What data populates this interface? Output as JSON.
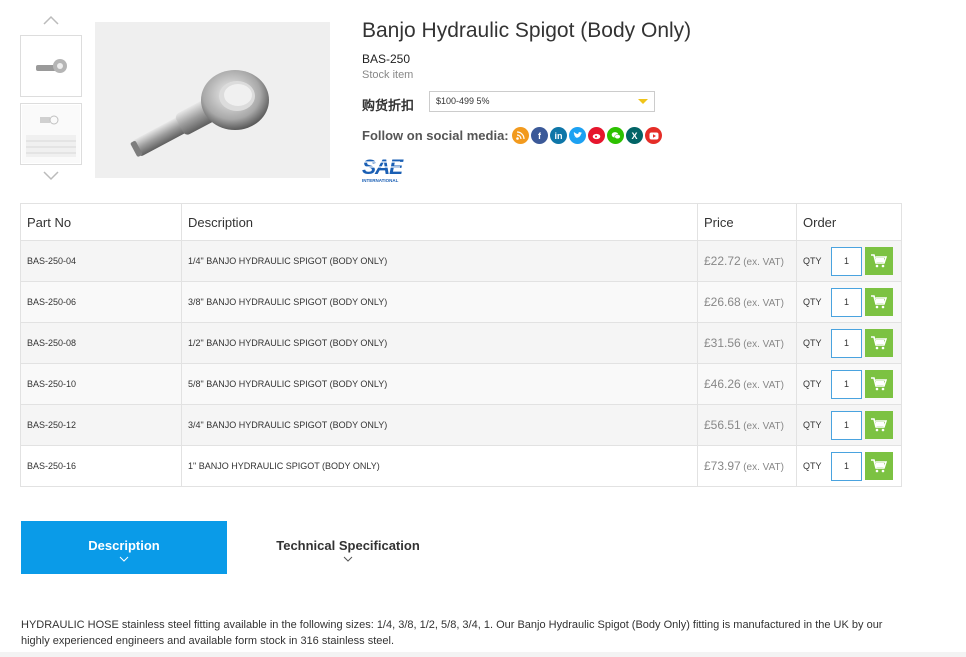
{
  "product": {
    "title": "Banjo Hydraulic Spigot (Body Only)",
    "sku": "BAS-250",
    "stock_status": "Stock item",
    "discount_label": "购货折扣",
    "discount_selected": "$100-499 5%",
    "social_label": "Follow on social media:",
    "social_icons": [
      "rss-icon",
      "facebook-icon",
      "linkedin-icon",
      "twitter-icon",
      "weibo-icon",
      "wechat-icon",
      "xing-icon",
      "youtube-icon"
    ],
    "logo_text": "SAE",
    "logo_subtext": "INTERNATIONAL"
  },
  "table": {
    "headers": {
      "part": "Part No",
      "description": "Description",
      "price": "Price",
      "order": "Order"
    },
    "vat_suffix": "(ex. VAT)",
    "qty_label": "QTY",
    "rows": [
      {
        "part": "BAS-250-04",
        "description": "1/4\" BANJO HYDRAULIC SPIGOT (BODY ONLY)",
        "price": "£22.72",
        "qty": "1"
      },
      {
        "part": "BAS-250-06",
        "description": "3/8\" BANJO HYDRAULIC SPIGOT (BODY ONLY)",
        "price": "£26.68",
        "qty": "1"
      },
      {
        "part": "BAS-250-08",
        "description": "1/2\" BANJO HYDRAULIC SPIGOT (BODY ONLY)",
        "price": "£31.56",
        "qty": "1"
      },
      {
        "part": "BAS-250-10",
        "description": "5/8\" BANJO HYDRAULIC SPIGOT (BODY ONLY)",
        "price": "£46.26",
        "qty": "1"
      },
      {
        "part": "BAS-250-12",
        "description": "3/4\" BANJO HYDRAULIC SPIGOT (BODY ONLY)",
        "price": "£56.51",
        "qty": "1"
      },
      {
        "part": "BAS-250-16",
        "description": "1\" BANJO HYDRAULIC SPIGOT (BODY ONLY)",
        "price": "£73.97",
        "qty": "1"
      }
    ]
  },
  "tabs": {
    "description": "Description",
    "technical": "Technical Specification"
  },
  "description_text": "HYDRAULIC HOSE stainless steel fitting available in the following sizes: 1/4, 3/8, 1/2, 5/8, 3/4, 1. Our Banjo Hydraulic Spigot (Body Only) fitting is manufactured in the UK by our highly experienced engineers and available form stock in 316 stainless steel.",
  "colors": {
    "accent_blue": "#0a9be8",
    "cart_green": "#7cc242",
    "dropdown_caret": "#f0c419"
  }
}
